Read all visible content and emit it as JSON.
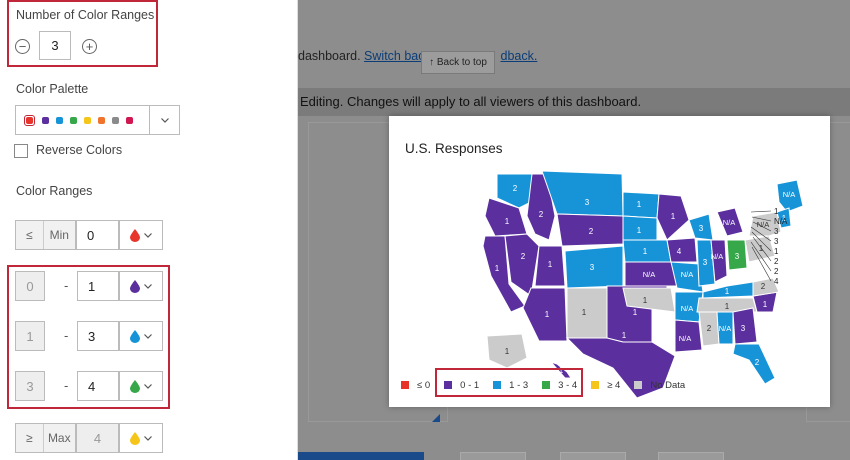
{
  "panel": {
    "num_ranges_label": "Number of Color Ranges",
    "num_ranges_value": "3",
    "palette_label": "Color Palette",
    "palette_colors": [
      "#e8352c",
      "#5b2f9e",
      "#1794d8",
      "#36a84a",
      "#f5c51a",
      "#f0742c",
      "#8a8a8a",
      "#d1174f"
    ],
    "reverse_label": "Reverse Colors",
    "ranges_label": "Color Ranges",
    "min_row": {
      "symbol": "≤",
      "text": "Min",
      "value": "0",
      "color": "#e8352c"
    },
    "ranges": [
      {
        "from": "0",
        "to": "1",
        "color": "#5b2f9e"
      },
      {
        "from": "1",
        "to": "3",
        "color": "#1794d8"
      },
      {
        "from": "3",
        "to": "4",
        "color": "#36a84a"
      }
    ],
    "max_row": {
      "symbol": "≥",
      "text": "Max",
      "value": "4",
      "color": "#f5c51a"
    }
  },
  "background": {
    "text1_prefix": "dashboard.",
    "text1_link": "Switch bac",
    "text1_link2": "dback.",
    "back_to_top": "↑ Back to top",
    "editing_notice": "Editing. Changes will apply to all viewers of this dashboard."
  },
  "map": {
    "title": "U.S. Responses",
    "colors": {
      "purple": "#5b2f9e",
      "blue": "#1794d8",
      "green": "#36a84a",
      "gray": "#cbcbcb"
    },
    "legend": [
      {
        "label": "≤ 0",
        "color": "#e8352c"
      },
      {
        "label": "0 - 1",
        "color": "#5b2f9e"
      },
      {
        "label": "1 - 3",
        "color": "#1794d8"
      },
      {
        "label": "3 - 4",
        "color": "#36a84a"
      },
      {
        "label": "≥ 4",
        "color": "#f5c51a"
      },
      {
        "label": "No Data",
        "color": "#cbcbcb"
      }
    ],
    "state_labels": [
      "2",
      "1",
      "1",
      "2",
      "2",
      "3",
      "2",
      "1",
      "3",
      "1",
      "1",
      "1",
      "1",
      "1",
      "N/A",
      "1",
      "1",
      "1",
      "1",
      "4",
      "N/A",
      "N/A",
      "N/A",
      "3",
      "3",
      "N/A",
      "N/A",
      "3",
      "1",
      "1",
      "2",
      "N/A",
      "3",
      "2",
      "1",
      "2",
      "1",
      "N/A",
      "N/A",
      "1",
      "1",
      "1",
      "1",
      "2",
      "N/A",
      "3",
      "1",
      "2",
      "2",
      "4"
    ],
    "callout_labels": [
      "1",
      "N/A",
      "3",
      "3",
      "1",
      "2",
      "2",
      "4"
    ]
  }
}
